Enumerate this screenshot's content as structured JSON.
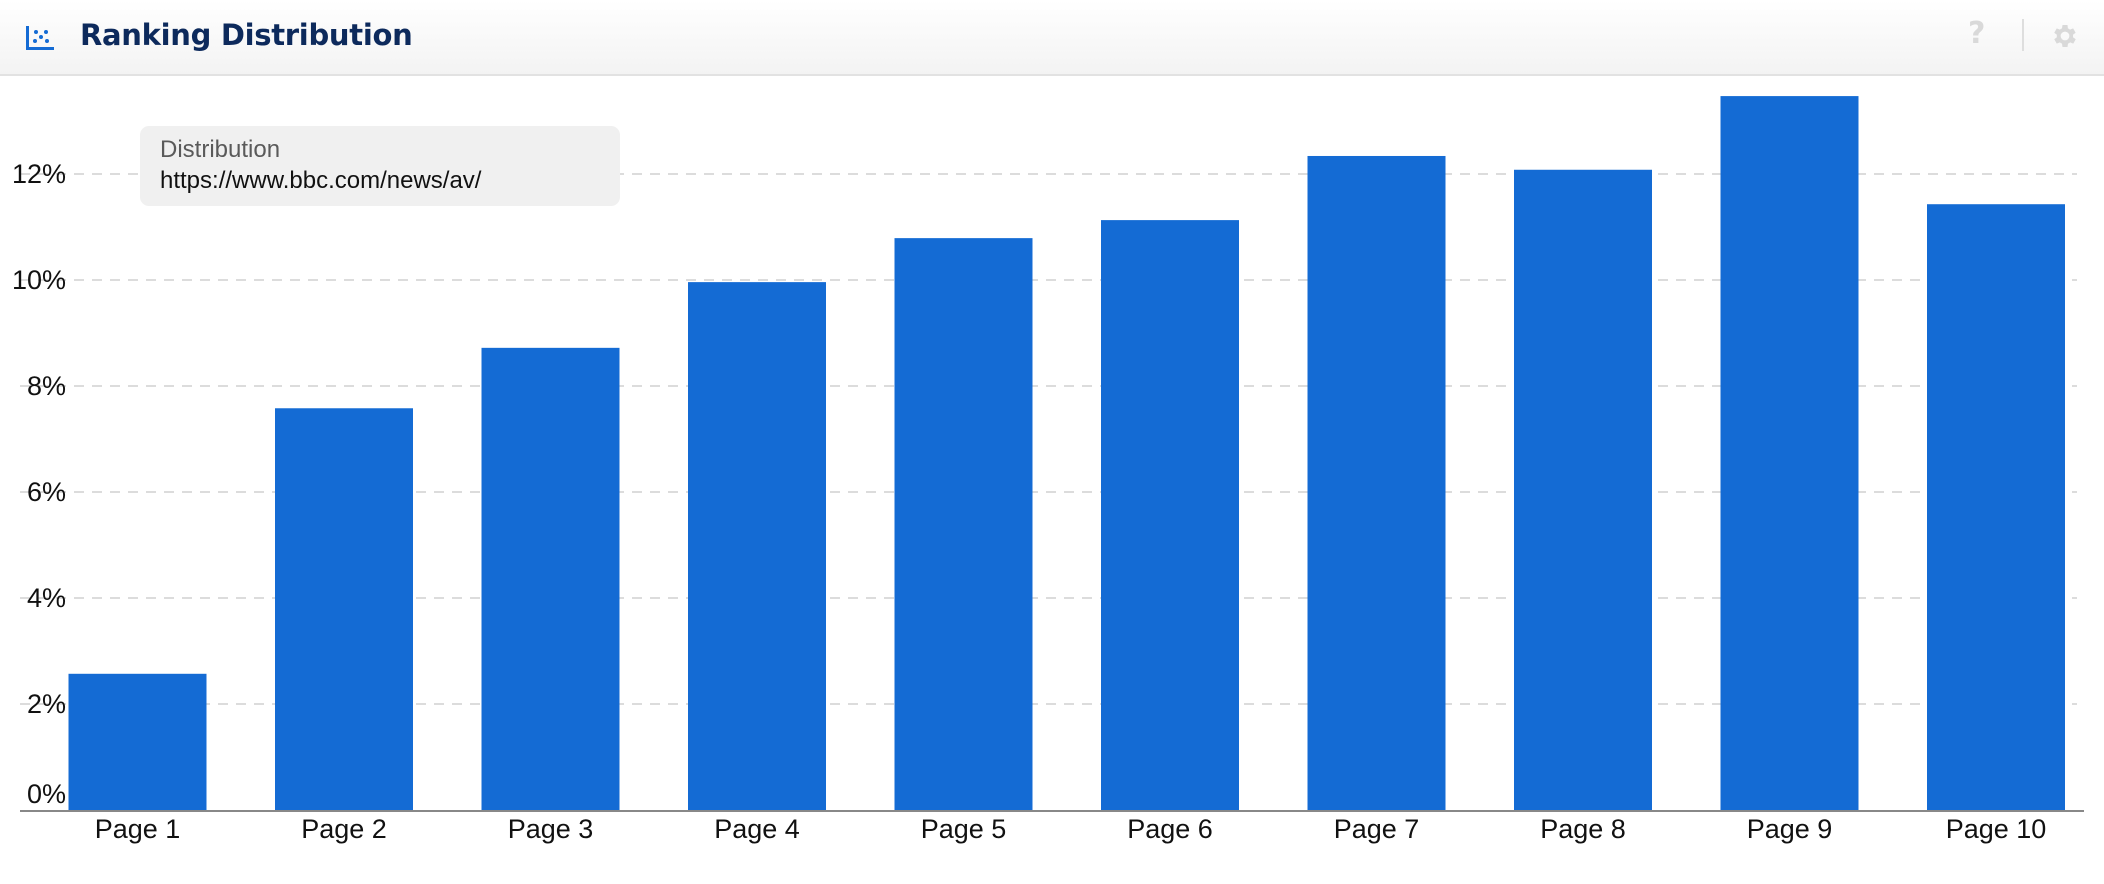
{
  "header": {
    "title": "Ranking Distribution",
    "icon": "scatter-chart-icon",
    "help_icon": "question-mark-icon",
    "help_glyph": "?",
    "settings_icon": "gear-icon"
  },
  "tooltip": {
    "title": "Distribution",
    "value": "https://www.bbc.com/news/av/"
  },
  "colors": {
    "bar": "#146bd4",
    "title": "#0d2a5c",
    "grid": "#dcdcdc",
    "axis": "#888888",
    "icon_muted": "#d9d9d9"
  },
  "chart_data": {
    "type": "bar",
    "title": "Ranking Distribution",
    "xlabel": "",
    "ylabel": "",
    "categories": [
      "Page 1",
      "Page 2",
      "Page 3",
      "Page 4",
      "Page 5",
      "Page 6",
      "Page 7",
      "Page 8",
      "Page 9",
      "Page 10"
    ],
    "series": [
      {
        "name": "https://www.bbc.com/news/av/",
        "values": [
          2.57,
          7.58,
          8.72,
          9.96,
          10.79,
          11.13,
          12.34,
          12.08,
          13.47,
          11.43
        ]
      }
    ],
    "value_unit": "%",
    "ylim": [
      0,
      13.47
    ],
    "yticks": [
      0,
      2,
      4,
      6,
      8,
      10,
      12
    ],
    "ytick_labels": [
      "0%",
      "2%",
      "4%",
      "6%",
      "8%",
      "10%",
      "12%"
    ],
    "grid": true,
    "grid_style": "dashed horizontal",
    "legend": "none"
  }
}
